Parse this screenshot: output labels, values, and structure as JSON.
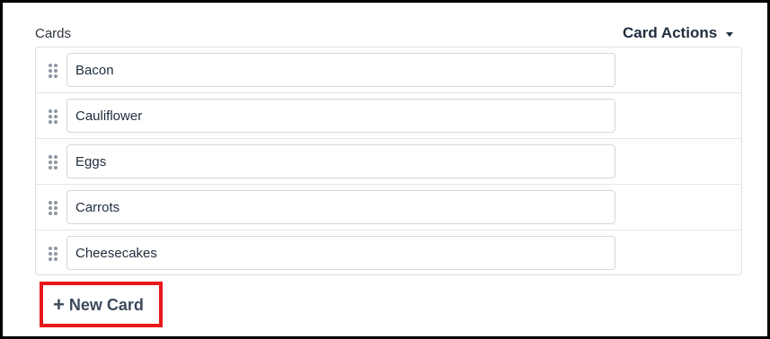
{
  "header": {
    "cards_label": "Cards",
    "card_actions_label": "Card Actions",
    "card_actions_icon": "caret-down-icon"
  },
  "cards": [
    {
      "value": "Bacon"
    },
    {
      "value": "Cauliflower"
    },
    {
      "value": "Eggs"
    },
    {
      "value": "Carrots"
    },
    {
      "value": "Cheesecakes"
    }
  ],
  "footer": {
    "new_card_icon": "plus-icon",
    "new_card_plus": "+",
    "new_card_label": "New Card",
    "highlight_color": "#e8171b"
  }
}
